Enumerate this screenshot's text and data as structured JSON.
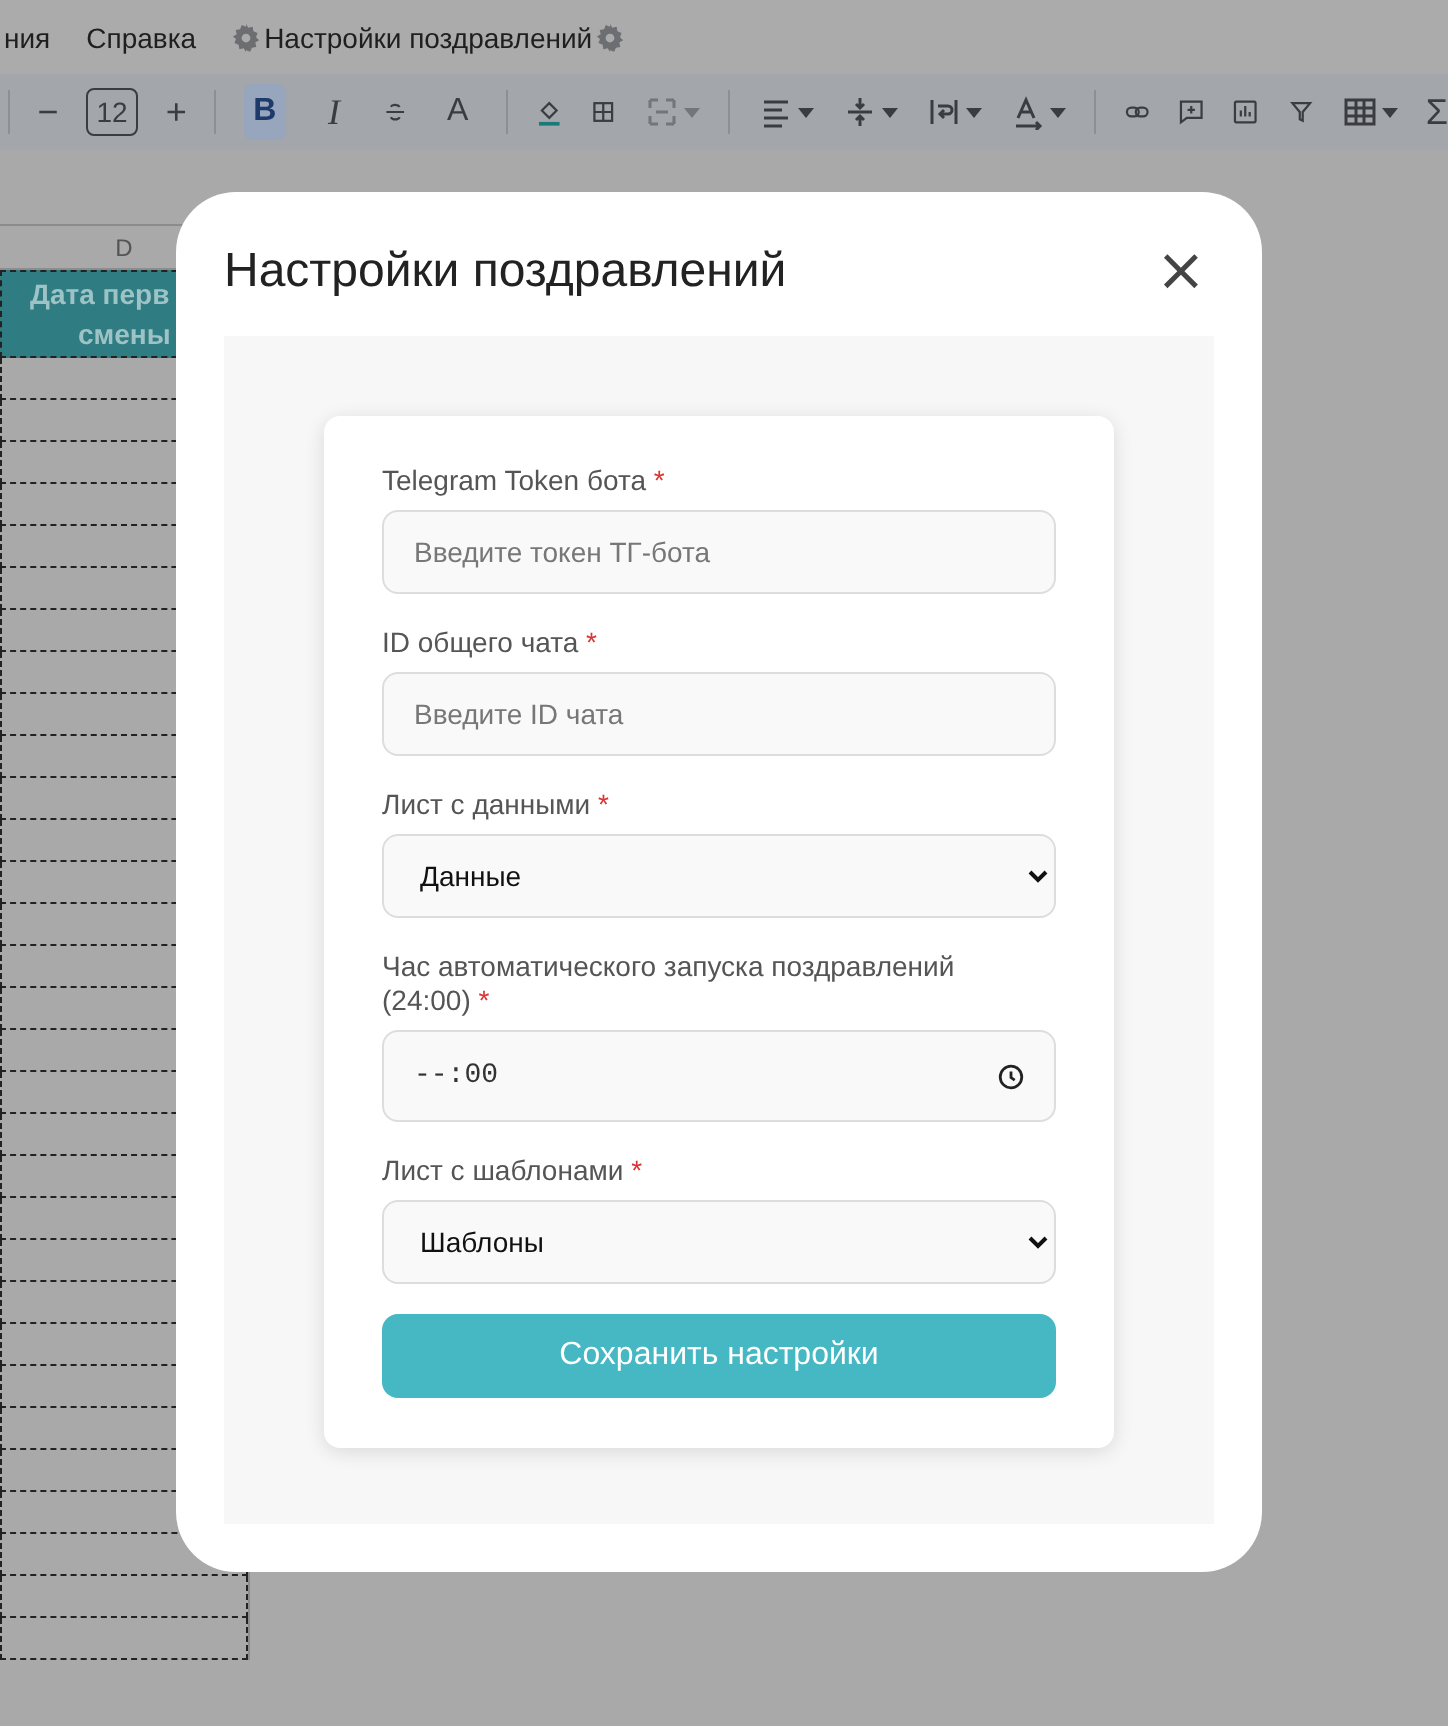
{
  "menu_bar": {
    "items": [
      {
        "label": "ния"
      },
      {
        "label": "Справка"
      }
    ],
    "addon_menu": {
      "label": "Настройки поздравлений"
    }
  },
  "toolbar": {
    "decrease": "−",
    "font_size": "12",
    "increase": "+",
    "bold": {
      "label": "B",
      "selected": true
    },
    "italic": {
      "label": "I",
      "selected": false
    },
    "text_color": "A",
    "merge_disabled": true,
    "sum": "Σ"
  },
  "sheet": {
    "column_header": "D",
    "header_cell_lines": [
      "Дата перв",
      "смены"
    ]
  },
  "dialog": {
    "title": "Настройки поздравлений",
    "close": "×",
    "fields": [
      {
        "kind": "text",
        "label": "Telegram Token бота",
        "required_mark": "*",
        "placeholder": "Введите токен ТГ-бота"
      },
      {
        "kind": "text",
        "label": "ID общего чата",
        "required_mark": "*",
        "placeholder": "Введите ID чата"
      },
      {
        "kind": "select",
        "label": "Лист с данными",
        "required_mark": "*",
        "value": "Данные"
      },
      {
        "kind": "time",
        "label": "Час автоматического запуска поздравлений (24:00)",
        "required_mark": "*",
        "value": "--:00"
      },
      {
        "kind": "select",
        "label": "Лист с шаблонами",
        "required_mark": "*",
        "value": "Шаблоны"
      }
    ],
    "save_button": "Сохранить настройки"
  }
}
